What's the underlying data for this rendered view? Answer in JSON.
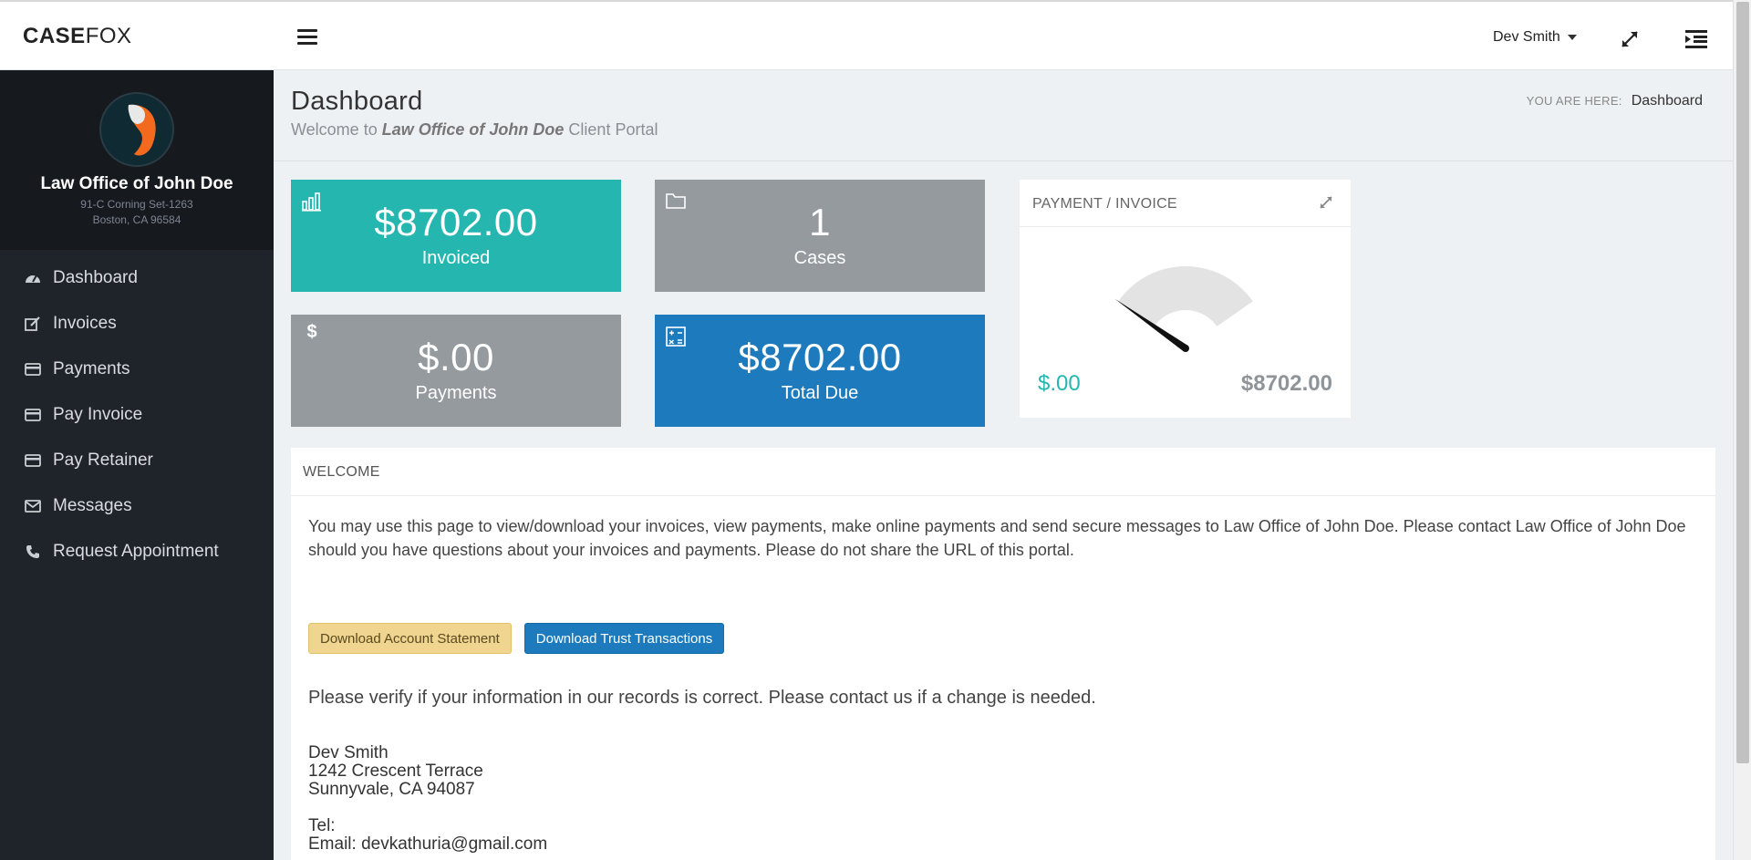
{
  "brand": {
    "bold": "CASE",
    "light": "FOX"
  },
  "topbar": {
    "user_name": "Dev Smith"
  },
  "sidebar": {
    "org_name": "Law Office of John Doe",
    "addr1": "91-C Corning Set-1263",
    "addr2": "Boston, CA 96584",
    "items": [
      {
        "label": "Dashboard",
        "icon": "dashboard-icon"
      },
      {
        "label": "Invoices",
        "icon": "edit-icon"
      },
      {
        "label": "Payments",
        "icon": "credit-card-icon"
      },
      {
        "label": "Pay Invoice",
        "icon": "credit-card-icon"
      },
      {
        "label": "Pay Retainer",
        "icon": "credit-card-icon"
      },
      {
        "label": "Messages",
        "icon": "envelope-icon"
      },
      {
        "label": "Request Appointment",
        "icon": "phone-icon"
      }
    ]
  },
  "header": {
    "title": "Dashboard",
    "welcome_prefix": "Welcome to",
    "welcome_firm": "Law Office of John Doe",
    "welcome_suffix": "Client Portal",
    "breadcrumb_label": "YOU ARE HERE:",
    "breadcrumb_current": "Dashboard"
  },
  "tiles": {
    "invoiced": {
      "value": "$8702.00",
      "label": "Invoiced"
    },
    "cases": {
      "value": "1",
      "label": "Cases"
    },
    "payments": {
      "value": "$.00",
      "label": "Payments"
    },
    "total_due": {
      "value": "$8702.00",
      "label": "Total Due"
    }
  },
  "gauge": {
    "title": "PAYMENT / INVOICE",
    "low_label": "$.00",
    "high_label": "$8702.00",
    "fraction": 0
  },
  "welcome": {
    "title": "WELCOME",
    "text": "You may use this page to view/download your invoices, view payments, make online payments and send secure messages to Law Office of John Doe. Please contact Law Office of John Doe should you have questions about your invoices and payments. Please do not share the URL of this portal.",
    "btn_statement": "Download Account Statement",
    "btn_trust": "Download Trust Transactions",
    "verify_text": "Please verify if your information in our records is correct. Please contact us if a change is needed.",
    "client_name": "Dev Smith",
    "client_street": "1242 Crescent Terrace",
    "client_city": "Sunnyvale, CA 94087",
    "tel_label": "Tel:",
    "email_line": "Email: devkathuria@gmail.com"
  },
  "colors": {
    "teal": "#26b6b0",
    "gray": "#959a9f",
    "blue": "#1d7bbd",
    "sidebar": "#1f242b"
  }
}
